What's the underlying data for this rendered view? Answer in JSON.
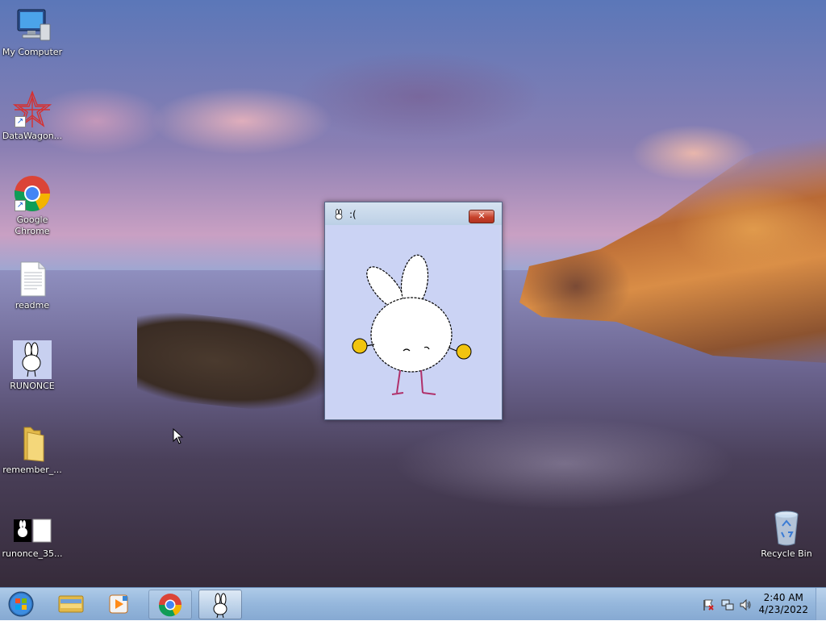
{
  "desktop": {
    "icons": [
      {
        "label": "My Computer",
        "icon": "computer-icon"
      },
      {
        "label": "DataWagon...",
        "icon": "datawagon-icon"
      },
      {
        "label": "Google Chrome",
        "icon": "chrome-icon"
      },
      {
        "label": "readme",
        "icon": "text-file-icon"
      },
      {
        "label": "RUNONCE",
        "icon": "bunny-app-icon"
      },
      {
        "label": "remember_...",
        "icon": "folder-icon"
      },
      {
        "label": "runonce_35...",
        "icon": "bunny-image-icon"
      },
      {
        "label": "Recycle Bin",
        "icon": "recycle-bin-icon"
      }
    ]
  },
  "window": {
    "title": ":(",
    "close_label": "✕"
  },
  "taskbar": {
    "start": "start-orb",
    "pinned": [
      "explorer-icon",
      "media-player-icon",
      "chrome-icon",
      "bunny-app-icon"
    ],
    "tray_icons": [
      "action-center-flag-icon",
      "network-icon",
      "volume-icon"
    ],
    "time": "2:40 AM",
    "date": "4/23/2022"
  },
  "colors": {
    "taskbar": "#95b7dc",
    "window_client": "#cbd3f4",
    "close_button": "#c7422c"
  }
}
